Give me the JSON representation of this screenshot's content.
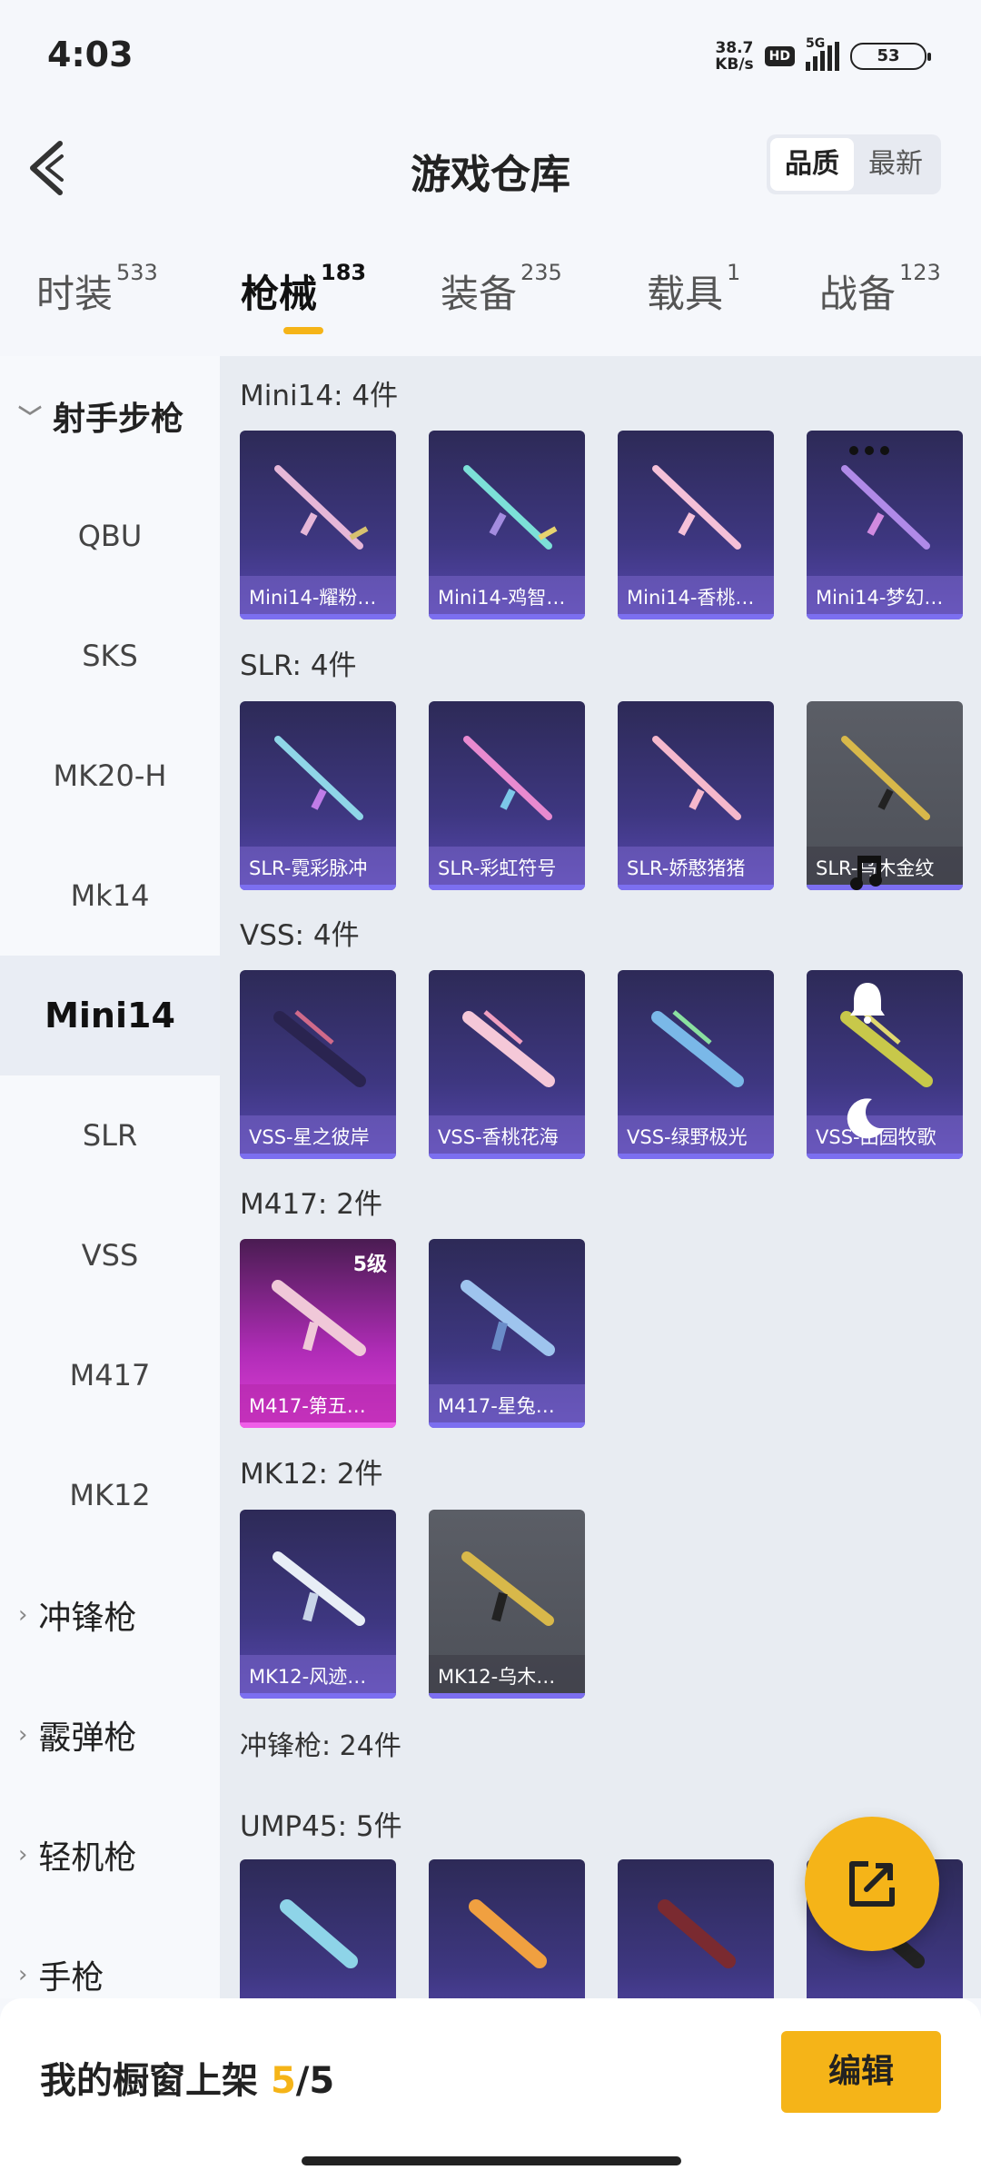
{
  "status": {
    "time": "4:03",
    "net_speed_top": "38.7",
    "net_speed_bottom": "KB/s",
    "hd": "HD",
    "net": "5G",
    "battery": "53"
  },
  "header": {
    "title": "游戏仓库",
    "sort": [
      "品质",
      "最新"
    ],
    "sort_active": 0
  },
  "tabs": [
    {
      "label": "时装",
      "count": "533"
    },
    {
      "label": "枪械",
      "count": "183"
    },
    {
      "label": "装备",
      "count": "235"
    },
    {
      "label": "载具",
      "count": "1"
    },
    {
      "label": "战备",
      "count": "123"
    }
  ],
  "sidebar": {
    "group_open": "射手步枪",
    "items": [
      "QBU",
      "SKS",
      "MK20-H",
      "Mk14",
      "Mini14",
      "SLR",
      "VSS",
      "M417",
      "MK12"
    ],
    "active": "Mini14",
    "groups_closed": [
      "冲锋枪",
      "霰弹枪",
      "轻机枪",
      "手枪"
    ]
  },
  "sections": [
    {
      "title": "Mini14: 4件",
      "items": [
        {
          "name": "Mini14-耀粉…",
          "style": "purple"
        },
        {
          "name": "Mini14-鸡智…",
          "style": "purple"
        },
        {
          "name": "Mini14-香桃…",
          "style": "purple"
        },
        {
          "name": "Mini14-梦幻…",
          "style": "purple"
        }
      ]
    },
    {
      "title": "SLR: 4件",
      "items": [
        {
          "name": "SLR-霓彩脉冲",
          "style": "purple"
        },
        {
          "name": "SLR-彩虹符号",
          "style": "purple"
        },
        {
          "name": "SLR-娇憨猪猪",
          "style": "purple"
        },
        {
          "name": "SLR-乌木金纹",
          "style": "gray"
        }
      ]
    },
    {
      "title": "VSS: 4件",
      "items": [
        {
          "name": "VSS-星之彼岸",
          "style": "purple"
        },
        {
          "name": "VSS-香桃花海",
          "style": "purple"
        },
        {
          "name": "VSS-绿野极光",
          "style": "purple"
        },
        {
          "name": "VSS-田园牧歌",
          "style": "purple"
        }
      ]
    },
    {
      "title": "M417: 2件",
      "items": [
        {
          "name": "M417-第五…",
          "style": "pink",
          "level": "5级"
        },
        {
          "name": "M417-星兔…",
          "style": "purple"
        }
      ]
    },
    {
      "title": "MK12: 2件",
      "items": [
        {
          "name": "MK12-风迹…",
          "style": "purple"
        },
        {
          "name": "MK12-乌木…",
          "style": "gray"
        }
      ]
    }
  ],
  "section_smg": {
    "title": "冲锋枪: 24件"
  },
  "section_ump": {
    "title": "UMP45: 5件"
  },
  "bottom": {
    "text": "我的橱窗上架",
    "current": "5",
    "total": "/5",
    "edit": "编辑"
  },
  "colors": {
    "accent": "#f5b418",
    "card_purple": "#3e3781",
    "card_pink": "#b02cb7",
    "card_gray": "#5b5e66"
  }
}
